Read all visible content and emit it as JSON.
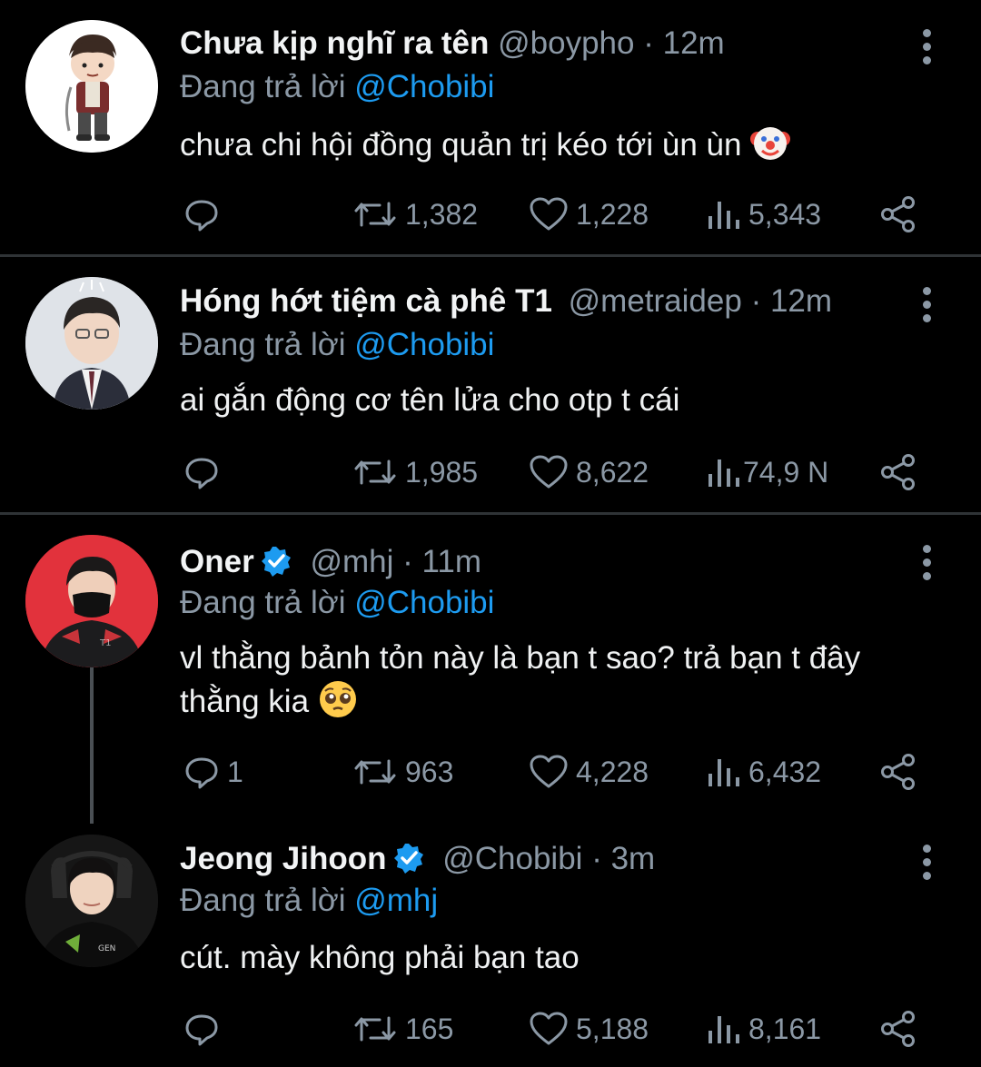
{
  "colors": {
    "background": "#000000",
    "divider": "#2f3336",
    "muted": "#8b98a5",
    "mention": "#1d9bf0",
    "verified": "#1d9bf0"
  },
  "reply_prefix": "Đang trả lời",
  "tweets": [
    {
      "name": "Chưa kịp nghĩ ra tên",
      "handle": "@boypho",
      "time": "· 12m",
      "verified": false,
      "reply_to": "@Chobibi",
      "text": "chưa chi hội đồng quản trị kéo tới ùn ùn",
      "emoji": "clown-face",
      "replies": "",
      "retweets": "1,382",
      "likes": "1,228",
      "views": "5,343"
    },
    {
      "name": "Hóng hớt tiệm cà phê T1",
      "handle": "@metraidep",
      "time": "· 12m",
      "verified": false,
      "reply_to": "@Chobibi",
      "text": "ai gắn động cơ tên lửa cho otp t cái",
      "emoji": "",
      "replies": "",
      "retweets": "1,985",
      "likes": "8,622",
      "views": "74,9 N"
    },
    {
      "name": "Oner",
      "handle": "@mhj",
      "time": "· 11m",
      "verified": true,
      "reply_to": "@Chobibi",
      "text_line1": "vl thằng bảnh tỏn này là bạn t sao? trả bạn t đây",
      "text_line2": "thằng kia",
      "emoji": "pleading-face",
      "replies": "1",
      "retweets": "963",
      "likes": "4,228",
      "views": "6,432"
    },
    {
      "name": "Jeong Jihoon",
      "handle": "@Chobibi",
      "time": "· 3m",
      "verified": true,
      "reply_to": "@mhj",
      "text": "cút. mày không phải bạn tao",
      "emoji": "",
      "replies": "",
      "retweets": "165",
      "likes": "5,188",
      "views": "8,161"
    }
  ]
}
